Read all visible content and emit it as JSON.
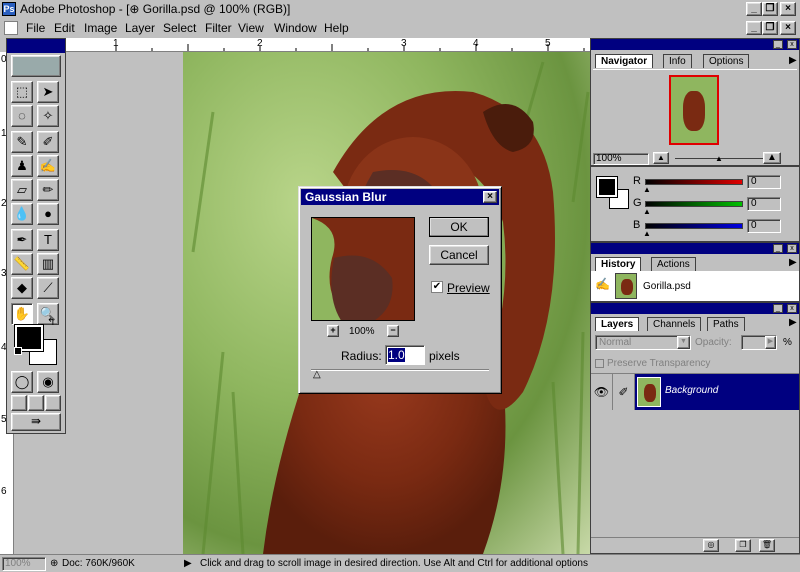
{
  "app": {
    "title": "Adobe Photoshop - [⊕ Gorilla.psd @ 100% (RGB)]",
    "icon": "photoshop-icon"
  },
  "window_controls": {
    "minimize": "_",
    "restore": "❐",
    "close": "×"
  },
  "menu": [
    "File",
    "Edit",
    "Image",
    "Layer",
    "Select",
    "Filter",
    "View",
    "Window",
    "Help"
  ],
  "rulers": {
    "top": [
      "1",
      "2",
      "3",
      "4",
      "5"
    ],
    "left": [
      "0",
      "1",
      "2",
      "3",
      "4",
      "5",
      "6"
    ]
  },
  "navigator": {
    "tabs": [
      "Navigator",
      "Info",
      "Options"
    ],
    "zoom": "100%"
  },
  "color": {
    "channels": [
      {
        "label": "R",
        "value": "0",
        "color": "#c00000"
      },
      {
        "label": "G",
        "value": "0",
        "color": "#008000"
      },
      {
        "label": "B",
        "value": "0",
        "color": "#0000c0"
      }
    ],
    "foreground": "#000000",
    "background": "#ffffff"
  },
  "history": {
    "tabs": [
      "History",
      "Actions"
    ],
    "items": [
      "Gorilla.psd"
    ]
  },
  "layers": {
    "tabs": [
      "Layers",
      "Channels",
      "Paths"
    ],
    "blend_mode": "Normal",
    "opacity_label": "Opacity:",
    "opacity_unit": "%",
    "preserve_label": "Preserve Transparency",
    "items": [
      "Background"
    ]
  },
  "dialog": {
    "title": "Gaussian Blur",
    "ok": "OK",
    "cancel": "Cancel",
    "preview_label": "Preview",
    "preview_checked": true,
    "zoom": "100%",
    "zoom_in": "+",
    "zoom_out": "−",
    "radius_label": "Radius:",
    "radius_value": "1.0",
    "radius_unit": "pixels"
  },
  "status": {
    "zoom": "100%",
    "doc": "Doc: 760K/960K",
    "message": "Click and drag to scroll image in desired direction.  Use Alt and Ctrl for additional options"
  }
}
